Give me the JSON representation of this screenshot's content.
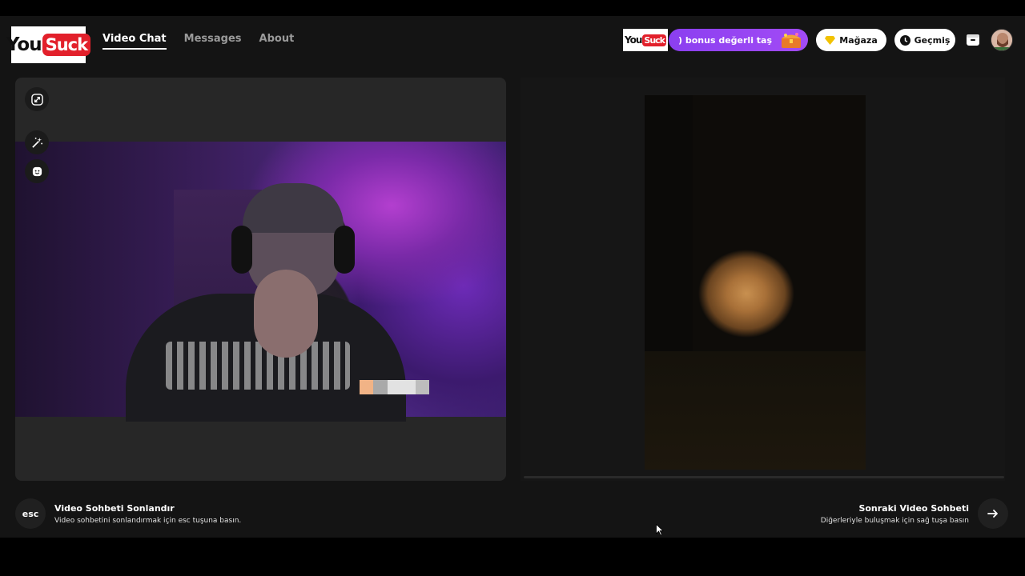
{
  "brand": {
    "you": "You",
    "suck": "Suck"
  },
  "nav": {
    "items": [
      {
        "label": "Video Chat",
        "active": true
      },
      {
        "label": "Messages",
        "active": false
      },
      {
        "label": "About",
        "active": false
      }
    ]
  },
  "header": {
    "bonus_text": ") bonus değerli taş",
    "store_label": "Mağaza",
    "history_label": "Geçmiş"
  },
  "icons": {
    "expand": "expand-icon",
    "magic": "magic-wand-icon",
    "emoji": "emoji-icon",
    "gem": "gem-icon",
    "clock": "clock-icon",
    "box": "archive-icon",
    "next": "arrow-right-icon"
  },
  "footer": {
    "esc_key": "esc",
    "end_title": "Video Sohbeti Sonlandır",
    "end_subtitle": "Video sohbetini sonlandırmak için esc tuşuna basın.",
    "next_title": "Sonraki Video Sohbeti",
    "next_subtitle": "Diğerleriyle buluşmak için sağ tuşa basın"
  },
  "colors": {
    "brand_red": "#e2202b",
    "bonus_purple": "#9b45f3",
    "background": "#141414",
    "panel": "#272727"
  }
}
